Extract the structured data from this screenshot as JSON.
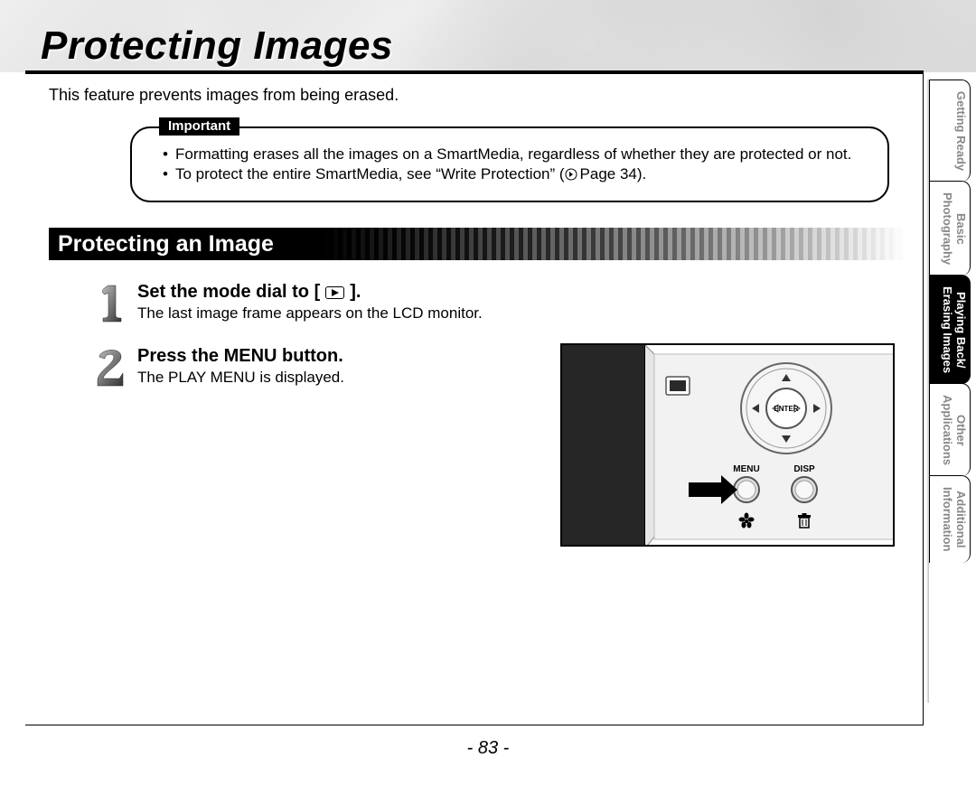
{
  "title": "Protecting Images",
  "intro": "This feature prevents images from being erased.",
  "important": {
    "label": "Important",
    "items": [
      "Formatting erases all the images on a SmartMedia, regardless of whether they are protected or not.",
      "To protect the entire SmartMedia, see “Write Protection” ( ➤ Page 34)."
    ]
  },
  "section_heading": "Protecting an Image",
  "steps": [
    {
      "title_pre": "Set the mode dial to [",
      "title_post": "].",
      "desc": "The last image frame appears on the LCD monitor."
    },
    {
      "title_full": "Press the MENU button.",
      "desc": "The PLAY MENU is displayed."
    }
  ],
  "camera_labels": {
    "enter": "ENTER",
    "menu": "MENU",
    "disp": "DISP"
  },
  "tabs": [
    {
      "line1": "Getting Ready",
      "active": false
    },
    {
      "line1": "Basic",
      "line2": "Photography",
      "active": false
    },
    {
      "line1": "Playing Back/",
      "line2": "Erasing Images",
      "active": true
    },
    {
      "line1": "Other",
      "line2": "Applications",
      "active": false
    },
    {
      "line1": "Additional",
      "line2": "Information",
      "active": false
    }
  ],
  "page_number": "- 83 -"
}
